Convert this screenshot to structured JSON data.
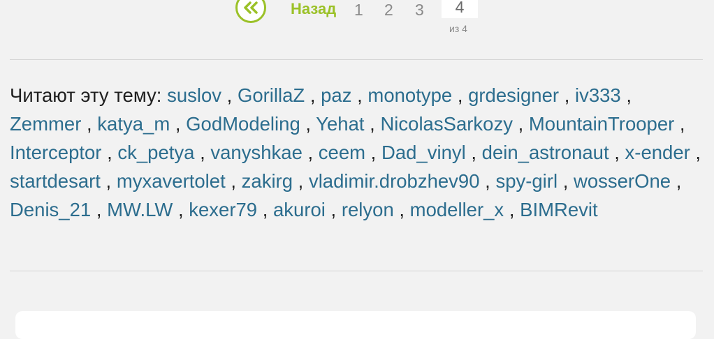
{
  "pagination": {
    "back_label": "Назад",
    "pages": [
      "1",
      "2",
      "3"
    ],
    "current": "4",
    "of_label": "из 4"
  },
  "readers": {
    "label": "Читают эту тему:",
    "users": [
      "suslov",
      "GorillaZ",
      "paz",
      "monotype",
      "grdesigner",
      "iv333",
      "Zemmer",
      "katya_m",
      "GodModeling",
      "Yehat",
      "NicolasSarkozy",
      "MountainTrooper",
      "Interceptor",
      "ck_petya",
      "vanyshkae",
      "ceem",
      "Dad_vinyl",
      "dein_astronaut",
      "x-ender",
      "startdesart",
      "myxavertolet",
      "zakirg",
      "vladimir.drobzhev90",
      "spy-girl",
      "wosserOne",
      "Denis_21",
      "MW.LW",
      "kexer79",
      "akuroi",
      "relyon",
      "modeller_x",
      "BIMRevit"
    ]
  },
  "colors": {
    "accent": "#9bc128",
    "link": "#2c6d8e",
    "background": "#f2f2f2"
  }
}
